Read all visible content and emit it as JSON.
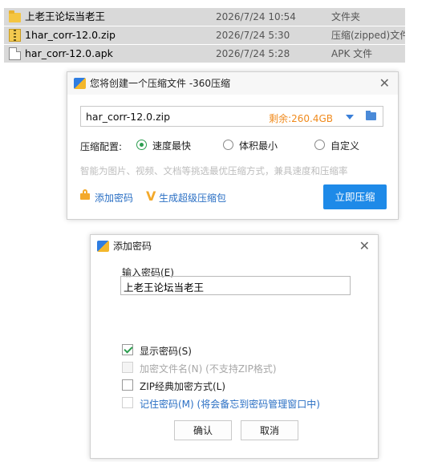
{
  "files": [
    {
      "icon": "folder-icon",
      "name": "上老王论坛当老王",
      "date": "2026/7/24 10:54",
      "type": "文件夹"
    },
    {
      "icon": "zip-file-icon",
      "name": "1har_corr-12.0.zip",
      "date": "2026/7/24 5:30",
      "type": "压缩(zipped)文件"
    },
    {
      "icon": "apk-file-icon",
      "name": "har_corr-12.0.apk",
      "date": "2026/7/24 5:28",
      "type": "APK 文件"
    }
  ],
  "compress_dialog": {
    "title": "您将创建一个压缩文件 -360压缩",
    "close": "✕",
    "path_value": "har_corr-12.0.zip",
    "free_space": "剩余:260.4GB",
    "config_label": "压缩配置:",
    "options": [
      "速度最快",
      "体积最小",
      "自定义"
    ],
    "selected_option": "速度最快",
    "hint": "智能为图片、视频、文档等挑选最优压缩方式，兼具速度和压缩率",
    "add_password": "添加密码",
    "super_package": "生成超级压缩包",
    "compress_button": "立即压缩",
    "accent_color": "#1e8ae8"
  },
  "password_dialog": {
    "title": "添加密码",
    "close": "✕",
    "input_label": "输入密码(E)",
    "password_value": "上老王论坛当老王",
    "checkboxes": [
      {
        "label": "显示密码(S)",
        "checked": true,
        "disabled": false
      },
      {
        "label": "加密文件名(N) (不支持ZIP格式)",
        "checked": false,
        "disabled": true
      },
      {
        "label": "ZIP经典加密方式(L)",
        "checked": false,
        "disabled": false
      },
      {
        "label": "记住密码(M) (将会备忘到密码管理窗口中)",
        "checked": false,
        "disabled": false
      }
    ],
    "ok": "确认",
    "cancel": "取消"
  }
}
